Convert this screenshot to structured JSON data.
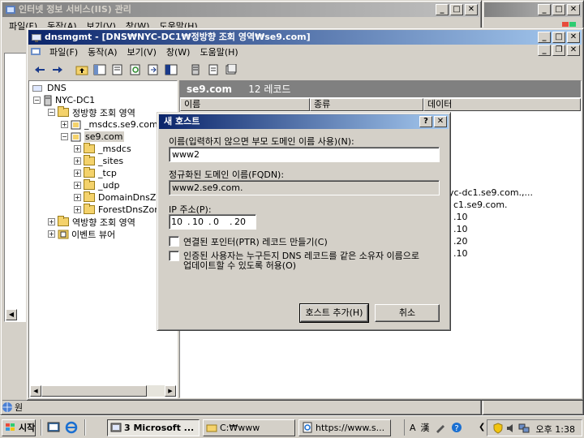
{
  "back_window": {
    "title": "인터넷 정보 서비스(IIS) 관리",
    "menu_partial": [
      "파일(F)",
      "동작(A)",
      "보기(V)",
      "창(W)",
      "도움말(H)"
    ]
  },
  "right_window": {
    "status_partial": "원"
  },
  "main_window": {
    "title": "dnsmgmt - [DNS₩NYC-DC1₩정방향 조회 영역₩se9.com]",
    "menu": [
      "파일(F)",
      "동작(A)",
      "보기(V)",
      "창(W)",
      "도움말(H)"
    ],
    "tree": [
      {
        "label": "DNS"
      },
      {
        "label": "NYC-DC1"
      },
      {
        "label": "정방향 조회 영역"
      },
      {
        "label": "_msdcs.se9.com"
      },
      {
        "label": "se9.com"
      },
      {
        "label": "_msdcs"
      },
      {
        "label": "_sites"
      },
      {
        "label": "_tcp"
      },
      {
        "label": "_udp"
      },
      {
        "label": "DomainDnsZo"
      },
      {
        "label": "ForestDnsZon"
      },
      {
        "label": "역방향 조회 영역"
      },
      {
        "label": "이벤트 뷰어"
      }
    ],
    "list_header": {
      "zone": "se9.com",
      "count": "12 레코드"
    },
    "columns": [
      "이름",
      "종류",
      "데이터"
    ],
    "data_fragments": [
      "yc-dc1.se9.com.,...",
      "c1.se9.com.",
      ".10",
      ".10",
      ".20",
      ".10"
    ]
  },
  "dialog": {
    "title": "새 호스트",
    "help_btn": "?",
    "close_btn": "✕",
    "name_label": "이름(입력하지 않으면 부모 도메인 이름 사용)(N):",
    "name_value": "www2",
    "fqdn_label": "정규화된 도메인 이름(FQDN):",
    "fqdn_value": "www2.se9.com.",
    "ip_label": "IP 주소(P):",
    "ip_octets": [
      "10",
      "10",
      "0",
      "20"
    ],
    "ip_dot": ".",
    "ptr_label": "연결된 포인터(PTR) 레코드 만들기(C)",
    "allow_label_1": "인증된 사용자는 누구든지 DNS 레코드를 같은 소유자 이름으로",
    "allow_label_2": "업데이트할 수 있도록 허용(O)",
    "add_button": "호스트 추가(H)",
    "cancel_button": "취소"
  },
  "taskbar": {
    "start": "시작",
    "tasks": [
      "3 Microsoft ...",
      "C:₩www",
      "https://www.s..."
    ],
    "tray_text": [
      "A",
      "漢"
    ],
    "clock": "오후 1:38"
  },
  "colors": {
    "titlebar_active": "#0a246a",
    "desktop": "#3a6ea5",
    "face": "#d4d0c8"
  }
}
